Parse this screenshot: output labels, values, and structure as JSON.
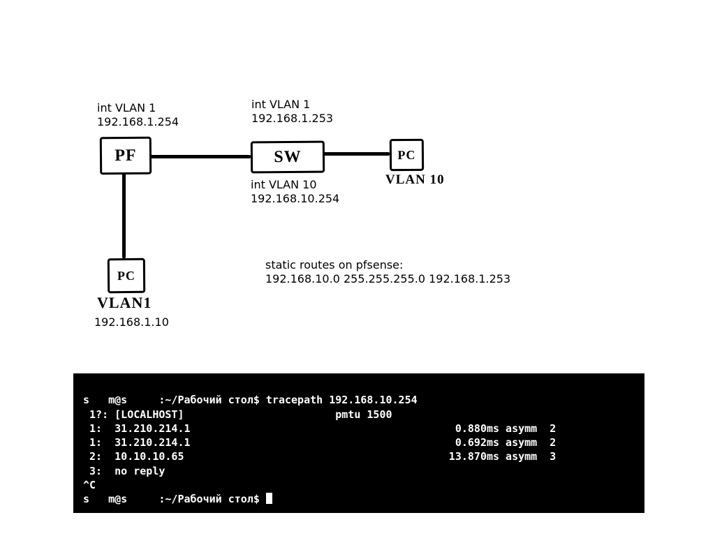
{
  "labels": {
    "pf_vlan": "int VLAN 1\n192.168.1.254",
    "sw_vlan1": "int VLAN 1\n192.168.1.253",
    "sw_vlan10": "int VLAN 10\n192.168.10.254",
    "pc2_vlan": "VLAN 10",
    "pc1_vlan": "VLAN1",
    "pc1_ip": "192.168.1.10",
    "routes": "static routes on pfsense:\n192.168.10.0 255.255.255.0 192.168.1.253"
  },
  "boxes": {
    "pf": "PF",
    "sw": "SW",
    "pc1": "PC",
    "pc2": "PC"
  },
  "terminal": {
    "prompt1_user": "s   m@s     ",
    "prompt1_path": ":~/Рабочий стол$ ",
    "cmd": "tracepath 192.168.10.254",
    "l0": " 1?: [LOCALHOST]                        pmtu 1500",
    "l1": " 1:  31.210.214.1                                          0.880ms asymm  2",
    "l2": " 1:  31.210.214.1                                          0.692ms asymm  2",
    "l3": " 2:  10.10.10.65                                          13.870ms asymm  3",
    "l4": " 3:  no reply",
    "break": "^C",
    "prompt2_user": "s   m@s     ",
    "prompt2_path": ":~/Рабочий стол$ "
  }
}
